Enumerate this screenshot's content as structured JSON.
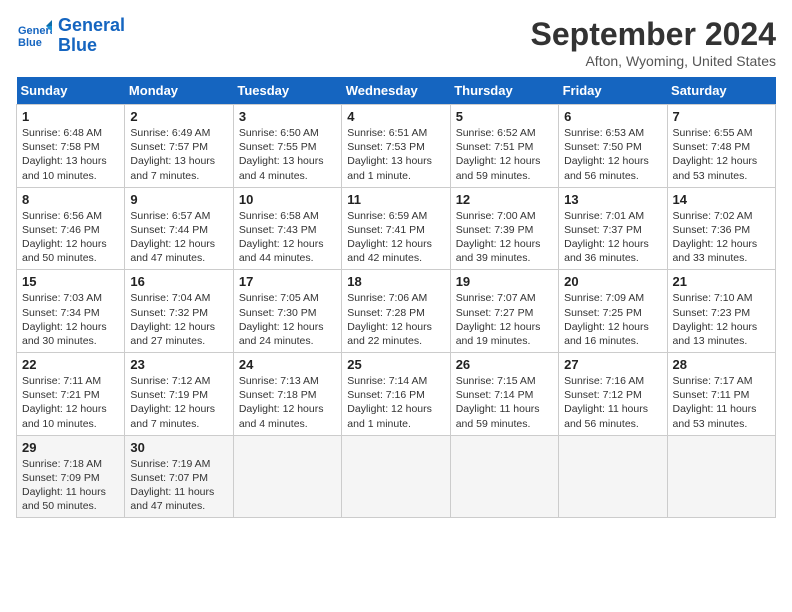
{
  "logo": {
    "line1": "General",
    "line2": "Blue"
  },
  "title": "September 2024",
  "subtitle": "Afton, Wyoming, United States",
  "days_of_week": [
    "Sunday",
    "Monday",
    "Tuesday",
    "Wednesday",
    "Thursday",
    "Friday",
    "Saturday"
  ],
  "weeks": [
    [
      {
        "day": "1",
        "info": "Sunrise: 6:48 AM\nSunset: 7:58 PM\nDaylight: 13 hours and 10 minutes."
      },
      {
        "day": "2",
        "info": "Sunrise: 6:49 AM\nSunset: 7:57 PM\nDaylight: 13 hours and 7 minutes."
      },
      {
        "day": "3",
        "info": "Sunrise: 6:50 AM\nSunset: 7:55 PM\nDaylight: 13 hours and 4 minutes."
      },
      {
        "day": "4",
        "info": "Sunrise: 6:51 AM\nSunset: 7:53 PM\nDaylight: 13 hours and 1 minute."
      },
      {
        "day": "5",
        "info": "Sunrise: 6:52 AM\nSunset: 7:51 PM\nDaylight: 12 hours and 59 minutes."
      },
      {
        "day": "6",
        "info": "Sunrise: 6:53 AM\nSunset: 7:50 PM\nDaylight: 12 hours and 56 minutes."
      },
      {
        "day": "7",
        "info": "Sunrise: 6:55 AM\nSunset: 7:48 PM\nDaylight: 12 hours and 53 minutes."
      }
    ],
    [
      {
        "day": "8",
        "info": "Sunrise: 6:56 AM\nSunset: 7:46 PM\nDaylight: 12 hours and 50 minutes."
      },
      {
        "day": "9",
        "info": "Sunrise: 6:57 AM\nSunset: 7:44 PM\nDaylight: 12 hours and 47 minutes."
      },
      {
        "day": "10",
        "info": "Sunrise: 6:58 AM\nSunset: 7:43 PM\nDaylight: 12 hours and 44 minutes."
      },
      {
        "day": "11",
        "info": "Sunrise: 6:59 AM\nSunset: 7:41 PM\nDaylight: 12 hours and 42 minutes."
      },
      {
        "day": "12",
        "info": "Sunrise: 7:00 AM\nSunset: 7:39 PM\nDaylight: 12 hours and 39 minutes."
      },
      {
        "day": "13",
        "info": "Sunrise: 7:01 AM\nSunset: 7:37 PM\nDaylight: 12 hours and 36 minutes."
      },
      {
        "day": "14",
        "info": "Sunrise: 7:02 AM\nSunset: 7:36 PM\nDaylight: 12 hours and 33 minutes."
      }
    ],
    [
      {
        "day": "15",
        "info": "Sunrise: 7:03 AM\nSunset: 7:34 PM\nDaylight: 12 hours and 30 minutes."
      },
      {
        "day": "16",
        "info": "Sunrise: 7:04 AM\nSunset: 7:32 PM\nDaylight: 12 hours and 27 minutes."
      },
      {
        "day": "17",
        "info": "Sunrise: 7:05 AM\nSunset: 7:30 PM\nDaylight: 12 hours and 24 minutes."
      },
      {
        "day": "18",
        "info": "Sunrise: 7:06 AM\nSunset: 7:28 PM\nDaylight: 12 hours and 22 minutes."
      },
      {
        "day": "19",
        "info": "Sunrise: 7:07 AM\nSunset: 7:27 PM\nDaylight: 12 hours and 19 minutes."
      },
      {
        "day": "20",
        "info": "Sunrise: 7:09 AM\nSunset: 7:25 PM\nDaylight: 12 hours and 16 minutes."
      },
      {
        "day": "21",
        "info": "Sunrise: 7:10 AM\nSunset: 7:23 PM\nDaylight: 12 hours and 13 minutes."
      }
    ],
    [
      {
        "day": "22",
        "info": "Sunrise: 7:11 AM\nSunset: 7:21 PM\nDaylight: 12 hours and 10 minutes."
      },
      {
        "day": "23",
        "info": "Sunrise: 7:12 AM\nSunset: 7:19 PM\nDaylight: 12 hours and 7 minutes."
      },
      {
        "day": "24",
        "info": "Sunrise: 7:13 AM\nSunset: 7:18 PM\nDaylight: 12 hours and 4 minutes."
      },
      {
        "day": "25",
        "info": "Sunrise: 7:14 AM\nSunset: 7:16 PM\nDaylight: 12 hours and 1 minute."
      },
      {
        "day": "26",
        "info": "Sunrise: 7:15 AM\nSunset: 7:14 PM\nDaylight: 11 hours and 59 minutes."
      },
      {
        "day": "27",
        "info": "Sunrise: 7:16 AM\nSunset: 7:12 PM\nDaylight: 11 hours and 56 minutes."
      },
      {
        "day": "28",
        "info": "Sunrise: 7:17 AM\nSunset: 7:11 PM\nDaylight: 11 hours and 53 minutes."
      }
    ],
    [
      {
        "day": "29",
        "info": "Sunrise: 7:18 AM\nSunset: 7:09 PM\nDaylight: 11 hours and 50 minutes."
      },
      {
        "day": "30",
        "info": "Sunrise: 7:19 AM\nSunset: 7:07 PM\nDaylight: 11 hours and 47 minutes."
      },
      {
        "day": "",
        "info": ""
      },
      {
        "day": "",
        "info": ""
      },
      {
        "day": "",
        "info": ""
      },
      {
        "day": "",
        "info": ""
      },
      {
        "day": "",
        "info": ""
      }
    ]
  ]
}
